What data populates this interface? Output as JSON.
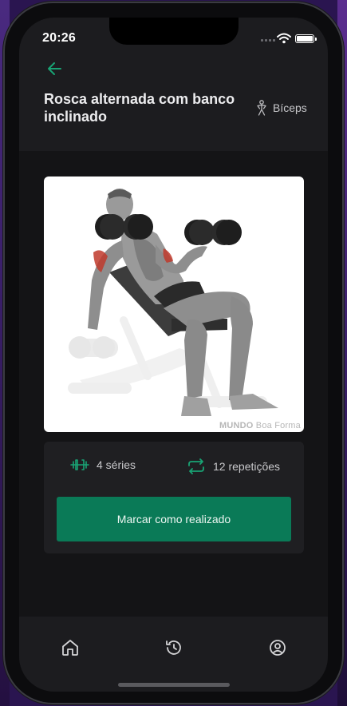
{
  "status_bar": {
    "time": "20:26"
  },
  "colors": {
    "accent": "#0a7a57",
    "accent_icon": "#19a374",
    "background": "#141416",
    "surface": "#1c1c1f"
  },
  "header": {
    "back_icon": "arrow-left-icon",
    "title": "Rosca alternada com banco inclinado",
    "muscle_icon": "body-figure-icon",
    "muscle_group": "Bíceps"
  },
  "exercise_image": {
    "watermark_brand": "MUNDO",
    "watermark_suffix": "Boa Forma"
  },
  "details": {
    "sets_icon": "dumbbell-icon",
    "sets_label": "4 séries",
    "reps_icon": "repeat-icon",
    "reps_label": "12 repetições",
    "action_button": "Marcar como realizado"
  },
  "tab_bar": {
    "items": [
      {
        "icon": "home-icon"
      },
      {
        "icon": "history-icon"
      },
      {
        "icon": "profile-icon"
      }
    ]
  }
}
